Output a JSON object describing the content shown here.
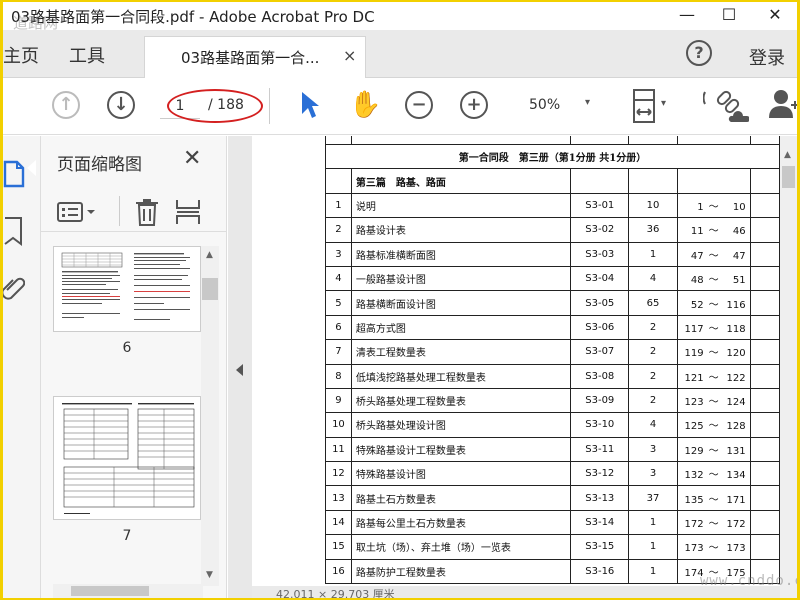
{
  "window": {
    "title": "03路基路面第一合同段.pdf - Adobe Acrobat Pro DC",
    "watermark": "道路网",
    "minimize": "—",
    "maximize": "☐",
    "close": "✕"
  },
  "tabs": {
    "home": "主页",
    "tools": "工具",
    "document": "03路基路面第一合...",
    "close": "×",
    "help": "?",
    "login": "登录"
  },
  "toolbar": {
    "prev_icon": "↑",
    "next_icon": "↓",
    "current_page": "1",
    "total_pages": "/ 188",
    "zoom_out": "−",
    "zoom_in": "+",
    "zoom": "50%",
    "dropdown": "▾"
  },
  "panel": {
    "title": "页面缩略图",
    "close": "✕",
    "thumbnails": [
      {
        "label": "6"
      },
      {
        "label": "7"
      }
    ]
  },
  "document": {
    "caption": "第一合同段　第三册（第1分册 共1分册）",
    "section": "第三篇　路基、路面",
    "tilde": "～",
    "rows": [
      {
        "no": "1",
        "name": "说明",
        "code": "S3-01",
        "pages": "10",
        "from": "1",
        "to": "10"
      },
      {
        "no": "2",
        "name": "路基设计表",
        "code": "S3-02",
        "pages": "36",
        "from": "11",
        "to": "46"
      },
      {
        "no": "3",
        "name": "路基标准横断面图",
        "code": "S3-03",
        "pages": "1",
        "from": "47",
        "to": "47"
      },
      {
        "no": "4",
        "name": "一般路基设计图",
        "code": "S3-04",
        "pages": "4",
        "from": "48",
        "to": "51"
      },
      {
        "no": "5",
        "name": "路基横断面设计图",
        "code": "S3-05",
        "pages": "65",
        "from": "52",
        "to": "116"
      },
      {
        "no": "6",
        "name": "超高方式图",
        "code": "S3-06",
        "pages": "2",
        "from": "117",
        "to": "118"
      },
      {
        "no": "7",
        "name": "清表工程数量表",
        "code": "S3-07",
        "pages": "2",
        "from": "119",
        "to": "120"
      },
      {
        "no": "8",
        "name": "低填浅挖路基处理工程数量表",
        "code": "S3-08",
        "pages": "2",
        "from": "121",
        "to": "122"
      },
      {
        "no": "9",
        "name": "桥头路基处理工程数量表",
        "code": "S3-09",
        "pages": "2",
        "from": "123",
        "to": "124"
      },
      {
        "no": "10",
        "name": "桥头路基处理设计图",
        "code": "S3-10",
        "pages": "4",
        "from": "125",
        "to": "128"
      },
      {
        "no": "11",
        "name": "特殊路基设计工程数量表",
        "code": "S3-11",
        "pages": "3",
        "from": "129",
        "to": "131"
      },
      {
        "no": "12",
        "name": "特殊路基设计图",
        "code": "S3-12",
        "pages": "3",
        "from": "132",
        "to": "134"
      },
      {
        "no": "13",
        "name": "路基土石方数量表",
        "code": "S3-13",
        "pages": "37",
        "from": "135",
        "to": "171"
      },
      {
        "no": "14",
        "name": "路基每公里土石方数量表",
        "code": "S3-14",
        "pages": "1",
        "from": "172",
        "to": "172"
      },
      {
        "no": "15",
        "name": "取土坑（场）、弃土堆（场）一览表",
        "code": "S3-15",
        "pages": "1",
        "from": "173",
        "to": "173"
      },
      {
        "no": "16",
        "name": "路基防护工程数量表",
        "code": "S3-16",
        "pages": "1",
        "from": "174",
        "to": "175"
      }
    ]
  },
  "status": {
    "dimensions": "42.011 × 29.703 厘米"
  },
  "site_watermark": "www.cnddo.com"
}
